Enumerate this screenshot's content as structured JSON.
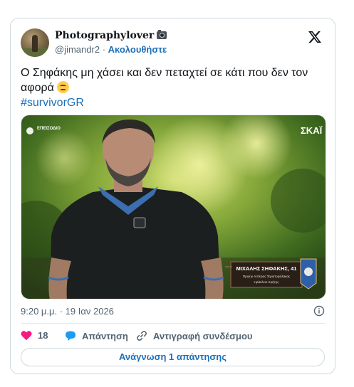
{
  "author": {
    "display_name": "Photographylover",
    "badge_icon": "camera-icon",
    "handle": "@jimandr2",
    "separator": "·",
    "follow_label": "Ακολουθήστε"
  },
  "platform_icon": "x-logo-icon",
  "tweet": {
    "text": "Ο Σηφάκης μη χάσει και δεν πεταχτεί σε κάτι που δεν τον αφορά",
    "emoji": "face-with-rolling-eyes-icon",
    "hashtag": "#survivorGR"
  },
  "media": {
    "channel_logo": "ΣΚΑΪ",
    "corner_badge": "ΕΠΕΙΣΟΔΙΟ",
    "lower_third": {
      "name": "ΜΙΧΑΛΗΣ ΣΗΦΑΚΗΣ, 41",
      "line2": "Πρώην Αστέρας Τεριστοφύλακας",
      "line3": "Ηράκλειο Κρήτης"
    }
  },
  "timestamp": "9:20 μ.μ. · 19 Ιαν 2026",
  "actions": {
    "likes_count": "18",
    "reply_label": "Απάντηση",
    "copy_link_label": "Αντιγραφή συνδέσμου"
  },
  "read_replies_label": "Ανάγνωση 1 απάντησης",
  "colors": {
    "accent": "#1d6fb8",
    "heart": "#f91880",
    "text_secondary": "#536471",
    "border": "#cfd9de"
  }
}
